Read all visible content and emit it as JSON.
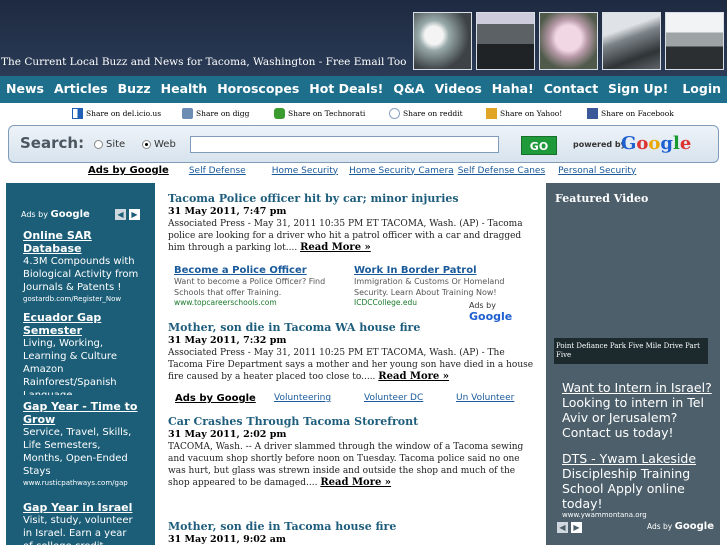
{
  "header": {
    "tagline": "The Current Local Buzz and News for Tacoma, Washington - Free Email Too"
  },
  "nav": {
    "left": [
      "News",
      "Articles",
      "Buzz",
      "Health",
      "Horoscopes",
      "Hot Deals!",
      "Q&A",
      "Videos",
      "Haha!",
      "Contact"
    ],
    "right": [
      "Sign Up!",
      "Login"
    ]
  },
  "share": [
    {
      "label": "Share on del.icio.us",
      "icon": "delicious-icon",
      "color": "#1f5fb6"
    },
    {
      "label": "Share on digg",
      "icon": "digg-icon",
      "color": "#6b8cb3"
    },
    {
      "label": "Share on Technorati",
      "icon": "technorati-icon",
      "color": "#3a9b2f"
    },
    {
      "label": "Share on reddit",
      "icon": "reddit-icon",
      "color": "#8aa2c0"
    },
    {
      "label": "Share on Yahoo!",
      "icon": "yahoo-icon",
      "color": "#e1a526"
    },
    {
      "label": "Share on Facebook",
      "icon": "facebook-icon",
      "color": "#3b5998"
    }
  ],
  "search": {
    "label": "Search:",
    "option_site": "Site",
    "option_web": "Web",
    "selected": "Web",
    "query": "",
    "go": "GO",
    "powered_by": "powered by",
    "google": "Google"
  },
  "link_units": {
    "ads_by": "Ads by Google",
    "top": [
      "Self Defense",
      "Home Security",
      "Home Security Camera",
      "Self Defense Canes",
      "Personal Security"
    ],
    "middle": [
      "Volunteering",
      "Volunteer DC",
      "Un Volunteer"
    ]
  },
  "left_ads": {
    "ads_by": "Ads by",
    "google": "Google",
    "items": [
      {
        "title": "Online SAR Database",
        "desc": "4.3M Compounds with Biological Activity from Journals & Patents !",
        "url": "gostardb.com/Register_Now"
      },
      {
        "title": "Ecuador Gap Semester",
        "desc": "Living, Working, Learning & Culture Amazon Rainforest/Spanish Language",
        "url": ""
      },
      {
        "title": "Gap Year - Time to Grow",
        "desc": "Service, Travel, Skills, Life Semesters, Months, Open-Ended Stays",
        "url": "www.rusticpathways.com/gap"
      },
      {
        "title": "Gap Year in Israel",
        "desc": "Visit, study, volunteer in Israel. Earn a year of college credit",
        "url": ""
      }
    ]
  },
  "articles": [
    {
      "title": "Tacoma Police officer hit by car; minor injuries",
      "date": "31 May 2011, 7:47 pm",
      "body": "Associated Press - May 31, 2011 10:35 PM ET TACOMA, Wash. (AP) - Tacoma police are looking for a driver who hit a patrol officer with a car and dragged him through a parking lot....",
      "more": "Read More »"
    },
    {
      "title": "Mother, son die in Tacoma WA house fire",
      "date": "31 May 2011, 7:32 pm",
      "body": "Associated Press - May 31, 2011 10:25 PM ET TACOMA, Wash. (AP) - The Tacoma Fire Department says a mother and her young son have died in a house fire caused by a heater placed too close to.....",
      "more": "Read More »"
    },
    {
      "title": "Car Crashes Through Tacoma Storefront",
      "date": "31 May 2011, 2:02 pm",
      "body": "TACOMA, Wash. -- A driver slammed through the window of a Tacoma sewing and vacuum shop shortly before noon on Tuesday. Tacoma police said no one was hurt, but glass was strewn inside and outside the shop and much of the shop appeared to be damaged....",
      "more": "Read More »"
    },
    {
      "title": "Mother, son die in Tacoma house fire",
      "date": "31 May 2011, 9:02 am",
      "body": "",
      "more": ""
    }
  ],
  "inline_ads": {
    "items": [
      {
        "title": "Become a Police Officer",
        "desc": "Want to become a Police Officer? Find Schools that offer Training.",
        "url": "www.topcareerschools.com"
      },
      {
        "title": "Work In Border Patrol",
        "desc": "Immigration & Customs Or Homeland Security. Learn About Training Now!",
        "url": "ICDCCollege.edu"
      }
    ],
    "ads_by": "Ads by",
    "google": "Google"
  },
  "right": {
    "featured_title": "Featured Video",
    "video_caption": "Point Defiance Park Five Mile Drive Part Five",
    "ads": [
      {
        "title": "Want to Intern in Israel?",
        "desc": "Looking to intern in Tel Aviv or Jerusalem? Contact us today!",
        "url": ""
      },
      {
        "title": "DTS - Ywam Lakeside",
        "desc": "Discipleship Training School Apply online today!",
        "url": "www.ywammontana.org"
      }
    ],
    "ads_by": "Ads by",
    "google": "Google"
  }
}
